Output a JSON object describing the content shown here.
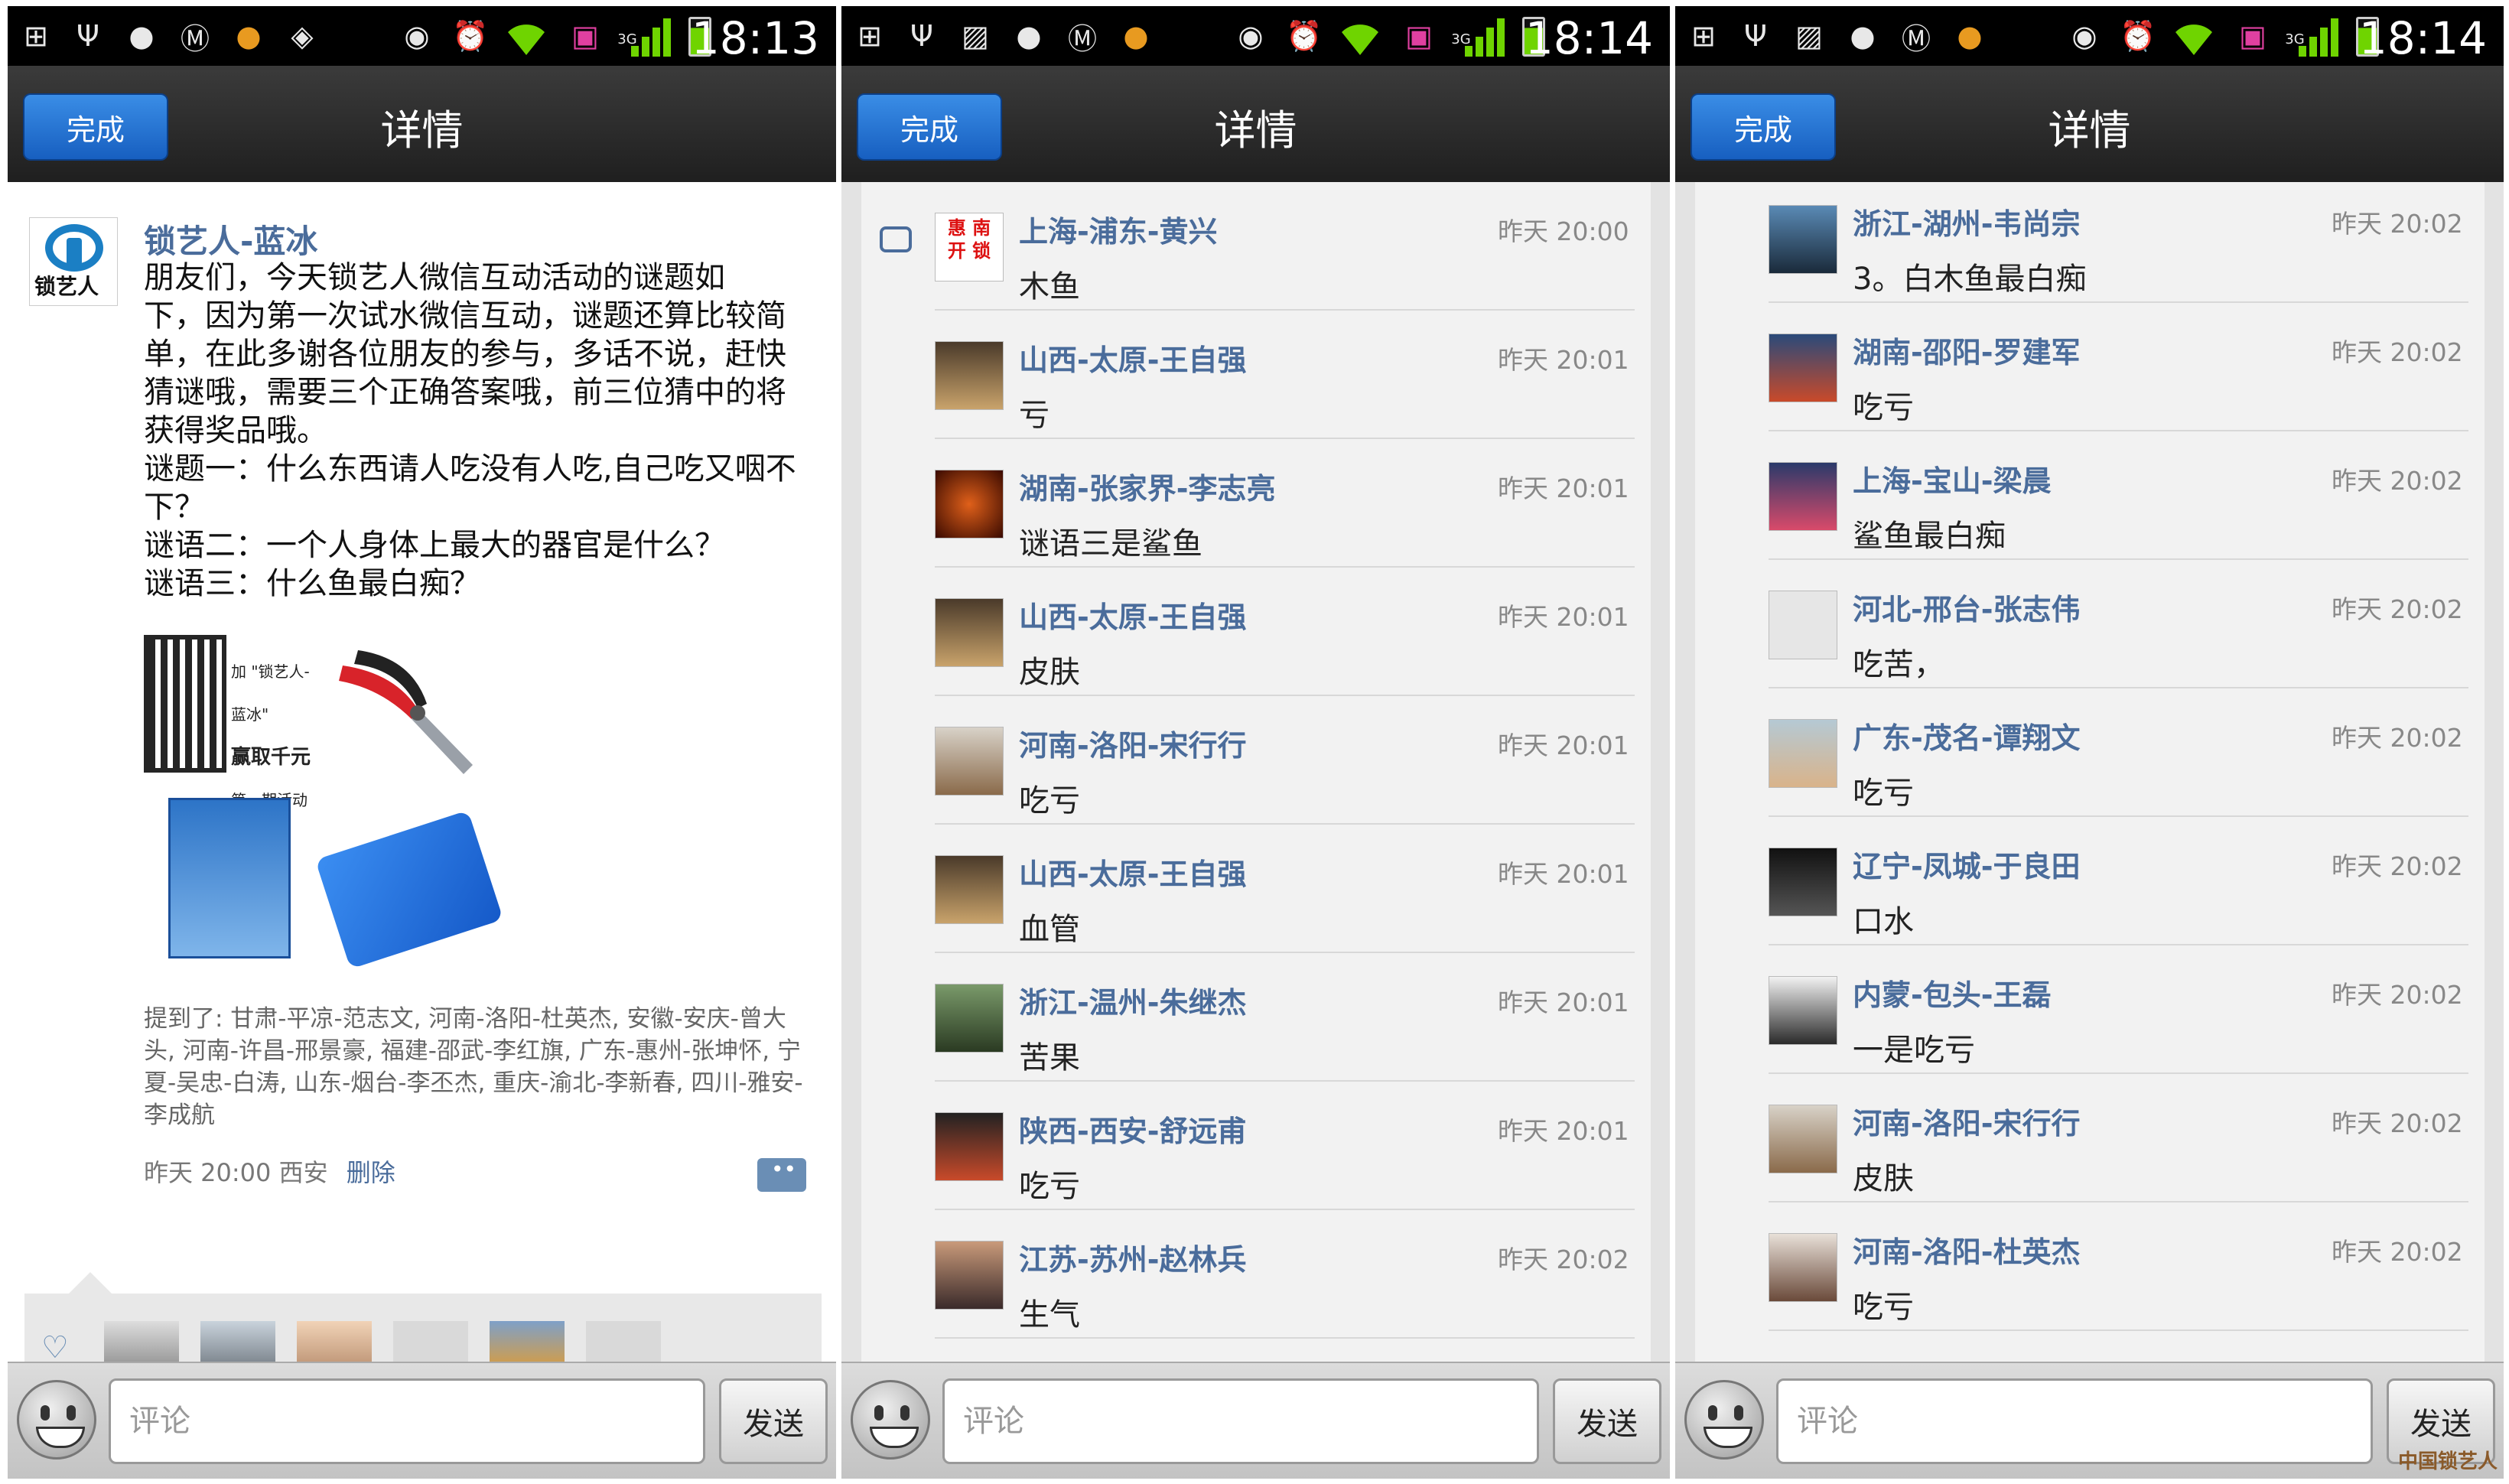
{
  "status_times": [
    "18:13",
    "18:14",
    "18:14"
  ],
  "network_badge": "3G",
  "nav": {
    "done_label": "完成",
    "title": "详情"
  },
  "post": {
    "author": "锁艺人-蓝冰",
    "avatar_text": "锁艺人",
    "body": "朋友们，今天锁艺人微信互动活动的谜题如\n下，因为第一次试水微信互动，谜题还算比较简\n单，在此多谢各位朋友的参与，多话不说，赶快\n猜谜哦，需要三个正确答案哦，前三位猜中的将\n获得奖品哦。\n谜题一：什么东西请人吃没有人吃,自己吃又咽不\n下？\n谜语二：一个人身体上最大的器官是什么？\n谜语三：什么鱼最白痴？",
    "ad_text_1": "加 \"锁艺人-蓝冰\"",
    "ad_text_2": "赢取千元",
    "ad_text_3": "第一期活动今!",
    "mention": "提到了: 甘肃-平凉-范志文, 河南-洛阳-杜英杰, 安徽-安庆-曾大头, 河南-许昌-邢景豪, 福建-邵武-李红旗, 广东-惠州-张坤怀, 宁夏-吴忠-白涛, 山东-烟台-李丕杰, 重庆-渝北-李新春, 四川-雅安-李成航",
    "time_loc": "昨天 20:00 西安",
    "delete_label": "删除"
  },
  "comments_p2": [
    {
      "name": "上海-浦东-黄兴",
      "time": "昨天 20:00",
      "text": "木鱼",
      "avatar_text": "惠 南 开 锁"
    },
    {
      "name": "山西-太原-王自强",
      "time": "昨天 20:01",
      "text": "亏"
    },
    {
      "name": "湖南-张家界-李志亮",
      "time": "昨天 20:01",
      "text": "谜语三是鲨鱼"
    },
    {
      "name": "山西-太原-王自强",
      "time": "昨天 20:01",
      "text": "皮肤"
    },
    {
      "name": "河南-洛阳-宋行行",
      "time": "昨天 20:01",
      "text": "吃亏"
    },
    {
      "name": "山西-太原-王自强",
      "time": "昨天 20:01",
      "text": "血管"
    },
    {
      "name": "浙江-温州-朱继杰",
      "time": "昨天 20:01",
      "text": "苦果"
    },
    {
      "name": "陕西-西安-舒远甫",
      "time": "昨天 20:01",
      "text": "吃亏"
    },
    {
      "name": "江苏-苏州-赵林兵",
      "time": "昨天 20:02",
      "text": "生气"
    }
  ],
  "comments_p3": [
    {
      "name": "浙江-湖州-韦尚宗",
      "time": "昨天 20:02",
      "text": "3。白木鱼最白痴"
    },
    {
      "name": "湖南-邵阳-罗建军",
      "time": "昨天 20:02",
      "text": "吃亏"
    },
    {
      "name": "上海-宝山-梁晨",
      "time": "昨天 20:02",
      "text": "鲨鱼最白痴"
    },
    {
      "name": "河北-邢台-张志伟",
      "time": "昨天 20:02",
      "text": "吃苦，"
    },
    {
      "name": "广东-茂名-谭翔文",
      "time": "昨天 20:02",
      "text": "吃亏"
    },
    {
      "name": "辽宁-凤城-于良田",
      "time": "昨天 20:02",
      "text": "口水"
    },
    {
      "name": "内蒙-包头-王磊",
      "time": "昨天 20:02",
      "text": "一是吃亏"
    },
    {
      "name": "河南-洛阳-宋行行",
      "time": "昨天 20:02",
      "text": "皮肤"
    },
    {
      "name": "河南-洛阳-杜英杰",
      "time": "昨天 20:02",
      "text": "吃亏"
    }
  ],
  "input": {
    "placeholder": "评论",
    "send_label": "发送"
  },
  "watermark": "中国锁艺人",
  "colors": {
    "accent_blue": "#1f6fd1",
    "name_blue": "#4a6c9b",
    "signal_green": "#6fd400"
  }
}
